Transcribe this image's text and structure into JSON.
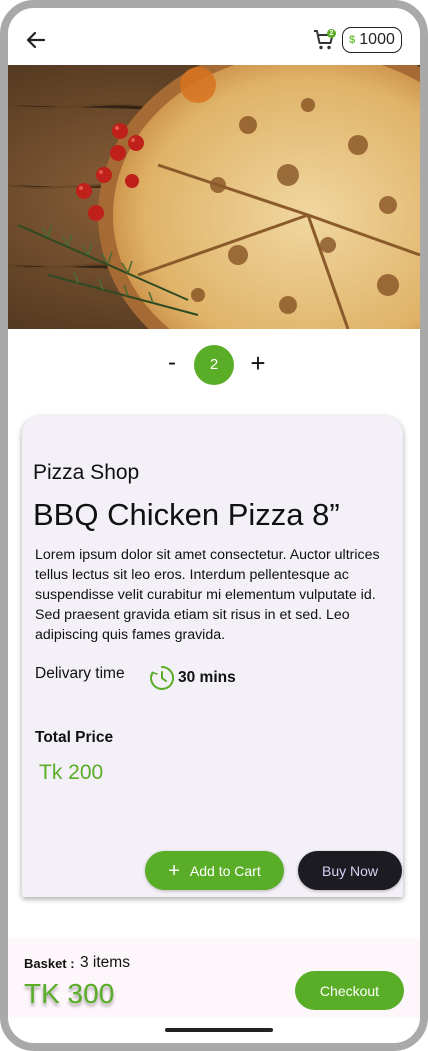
{
  "header": {
    "back_icon": "arrow-left-icon",
    "cart_icon": "shopping-cart-icon",
    "cart_badge": "2",
    "coin_icon_glyph": "$",
    "coin_balance": "1000"
  },
  "hero": {
    "image_subject": "pizza-photo"
  },
  "stepper": {
    "minus_label": "-",
    "quantity": "2",
    "plus_label": "+"
  },
  "product": {
    "shop_name": "Pizza Shop",
    "title": "BBQ Chicken Pizza 8”",
    "description": "Lorem ipsum dolor sit amet consectetur. Auctor ultrices tellus lectus sit leo eros. Interdum pellentesque ac suspendisse velit curabitur mi elementum vulputate id. Sed praesent gravida etiam sit risus in et sed. Leo adipiscing quis fames gravida.",
    "delivery_label": "Delivary time",
    "delivery_time": "30 mins",
    "total_label": "Total Price",
    "total_value": "Tk 200",
    "add_to_cart_label": "Add to Cart",
    "add_to_cart_icon": "+",
    "buy_now_label": "Buy Now"
  },
  "basket": {
    "label": "Basket :",
    "count": "3 items",
    "total": "TK 300",
    "checkout_label": "Checkout"
  },
  "colors": {
    "accent_green": "#5aad27",
    "dark_button": "#1c1b22",
    "card_bg": "#f4f0f7"
  }
}
